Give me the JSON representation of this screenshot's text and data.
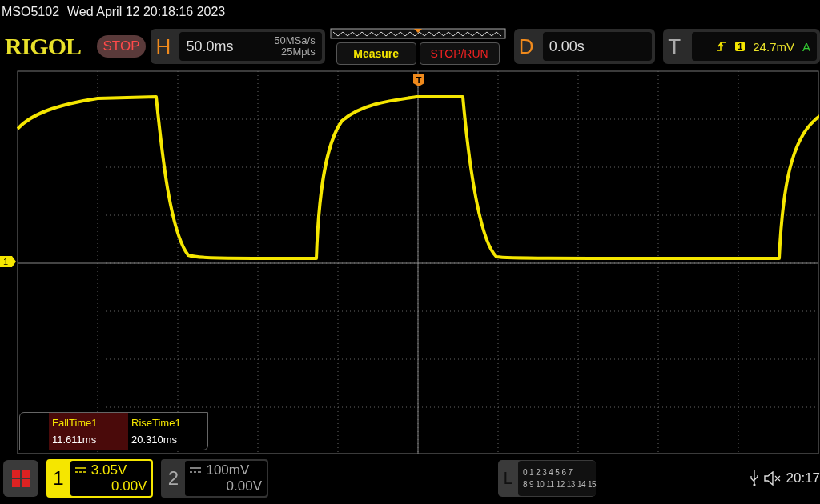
{
  "status_line": {
    "model": "MSO5102",
    "datetime": "Wed April 12 20:18:16 2023"
  },
  "header": {
    "logo": "RIGOL",
    "run_state": "STOP",
    "horizontal": {
      "label": "H",
      "timebase": "50.0ms",
      "sample_rate": "50MSa/s",
      "memory_depth": "25Mpts"
    },
    "buttons": [
      {
        "label": "Measure",
        "kind": "measure"
      },
      {
        "label": "STOP/RUN",
        "kind": "run"
      }
    ],
    "delay": {
      "label": "D",
      "value": "0.00s"
    },
    "trigger": {
      "label": "T",
      "source": "1",
      "level": "24.7mV",
      "mode": "A"
    }
  },
  "trigger_marker": "T",
  "channel_marker": "1",
  "measurements": [
    {
      "name": "FallTime1",
      "value": "11.611ms",
      "selected": true
    },
    {
      "name": "RiseTime1",
      "value": "20.310ms",
      "selected": false
    }
  ],
  "channels": [
    {
      "number": "1",
      "scale": "3.05V",
      "offset": "0.00V",
      "on": true
    },
    {
      "number": "2",
      "scale": "100mV",
      "offset": "0.00V",
      "on": false
    }
  ],
  "logic": {
    "label": "L",
    "row_1": [
      "0",
      "1",
      "2",
      "3",
      "4",
      "5",
      "6",
      "7"
    ],
    "row_2": [
      "8",
      "9",
      "10",
      "11",
      "12",
      "13",
      "14",
      "15"
    ]
  },
  "clock": "20:17"
}
